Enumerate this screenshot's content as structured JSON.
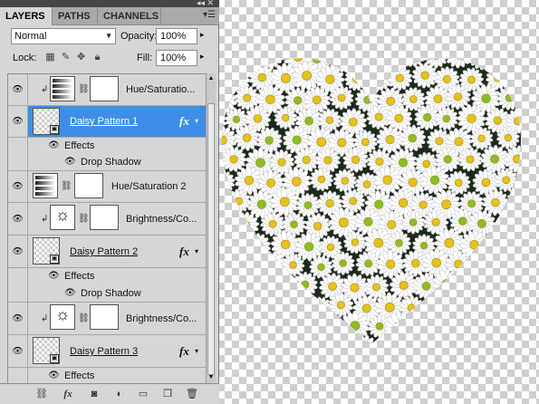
{
  "panel": {
    "tabs": [
      {
        "label": "LAYERS",
        "active": true
      },
      {
        "label": "PATHS",
        "active": false
      },
      {
        "label": "CHANNELS",
        "active": false
      }
    ],
    "blend_mode": "Normal",
    "opacity_label": "Opacity:",
    "opacity_value": "100%",
    "lock_label": "Lock:",
    "fill_label": "Fill:",
    "fill_value": "100%"
  },
  "layers": [
    {
      "kind": "adjustment",
      "name": "Hue/Saturatio...",
      "clipped": true,
      "visible": true,
      "icon": "hue-saturation-icon"
    },
    {
      "kind": "smart",
      "name": "Daisy Pattern 1",
      "selected": true,
      "fx": true,
      "visible": true
    },
    {
      "kind": "effects-header",
      "name": "Effects"
    },
    {
      "kind": "effect",
      "name": "Drop Shadow"
    },
    {
      "kind": "adjustment",
      "name": "Hue/Saturation 2",
      "clipped": false,
      "visible": true,
      "icon": "hue-saturation-icon"
    },
    {
      "kind": "adjustment",
      "name": "Brightness/Co...",
      "clipped": true,
      "visible": true,
      "icon": "brightness-contrast-icon"
    },
    {
      "kind": "smart",
      "name": "Daisy Pattern 2",
      "selected": false,
      "fx": true,
      "visible": true
    },
    {
      "kind": "effects-header",
      "name": "Effects"
    },
    {
      "kind": "effect",
      "name": "Drop Shadow"
    },
    {
      "kind": "adjustment",
      "name": "Brightness/Co...",
      "clipped": true,
      "visible": true,
      "icon": "brightness-contrast-icon"
    },
    {
      "kind": "smart",
      "name": "Daisy Pattern 3",
      "selected": false,
      "fx": true,
      "visible": true
    },
    {
      "kind": "effects-header",
      "name": "Effects"
    }
  ],
  "footer_buttons": [
    "link-layers-icon",
    "add-style-icon",
    "add-mask-icon",
    "adjustment-layer-icon",
    "group-icon",
    "new-layer-icon",
    "trash-icon"
  ],
  "colors": {
    "selection": "#3d8ee7",
    "panel_bg": "#d6d6d6",
    "tab_bar": "#a9a9a9",
    "petal": "#ffffff",
    "daisy_center": "#e5c21d",
    "daisy_center_green": "#8bbd2a"
  }
}
